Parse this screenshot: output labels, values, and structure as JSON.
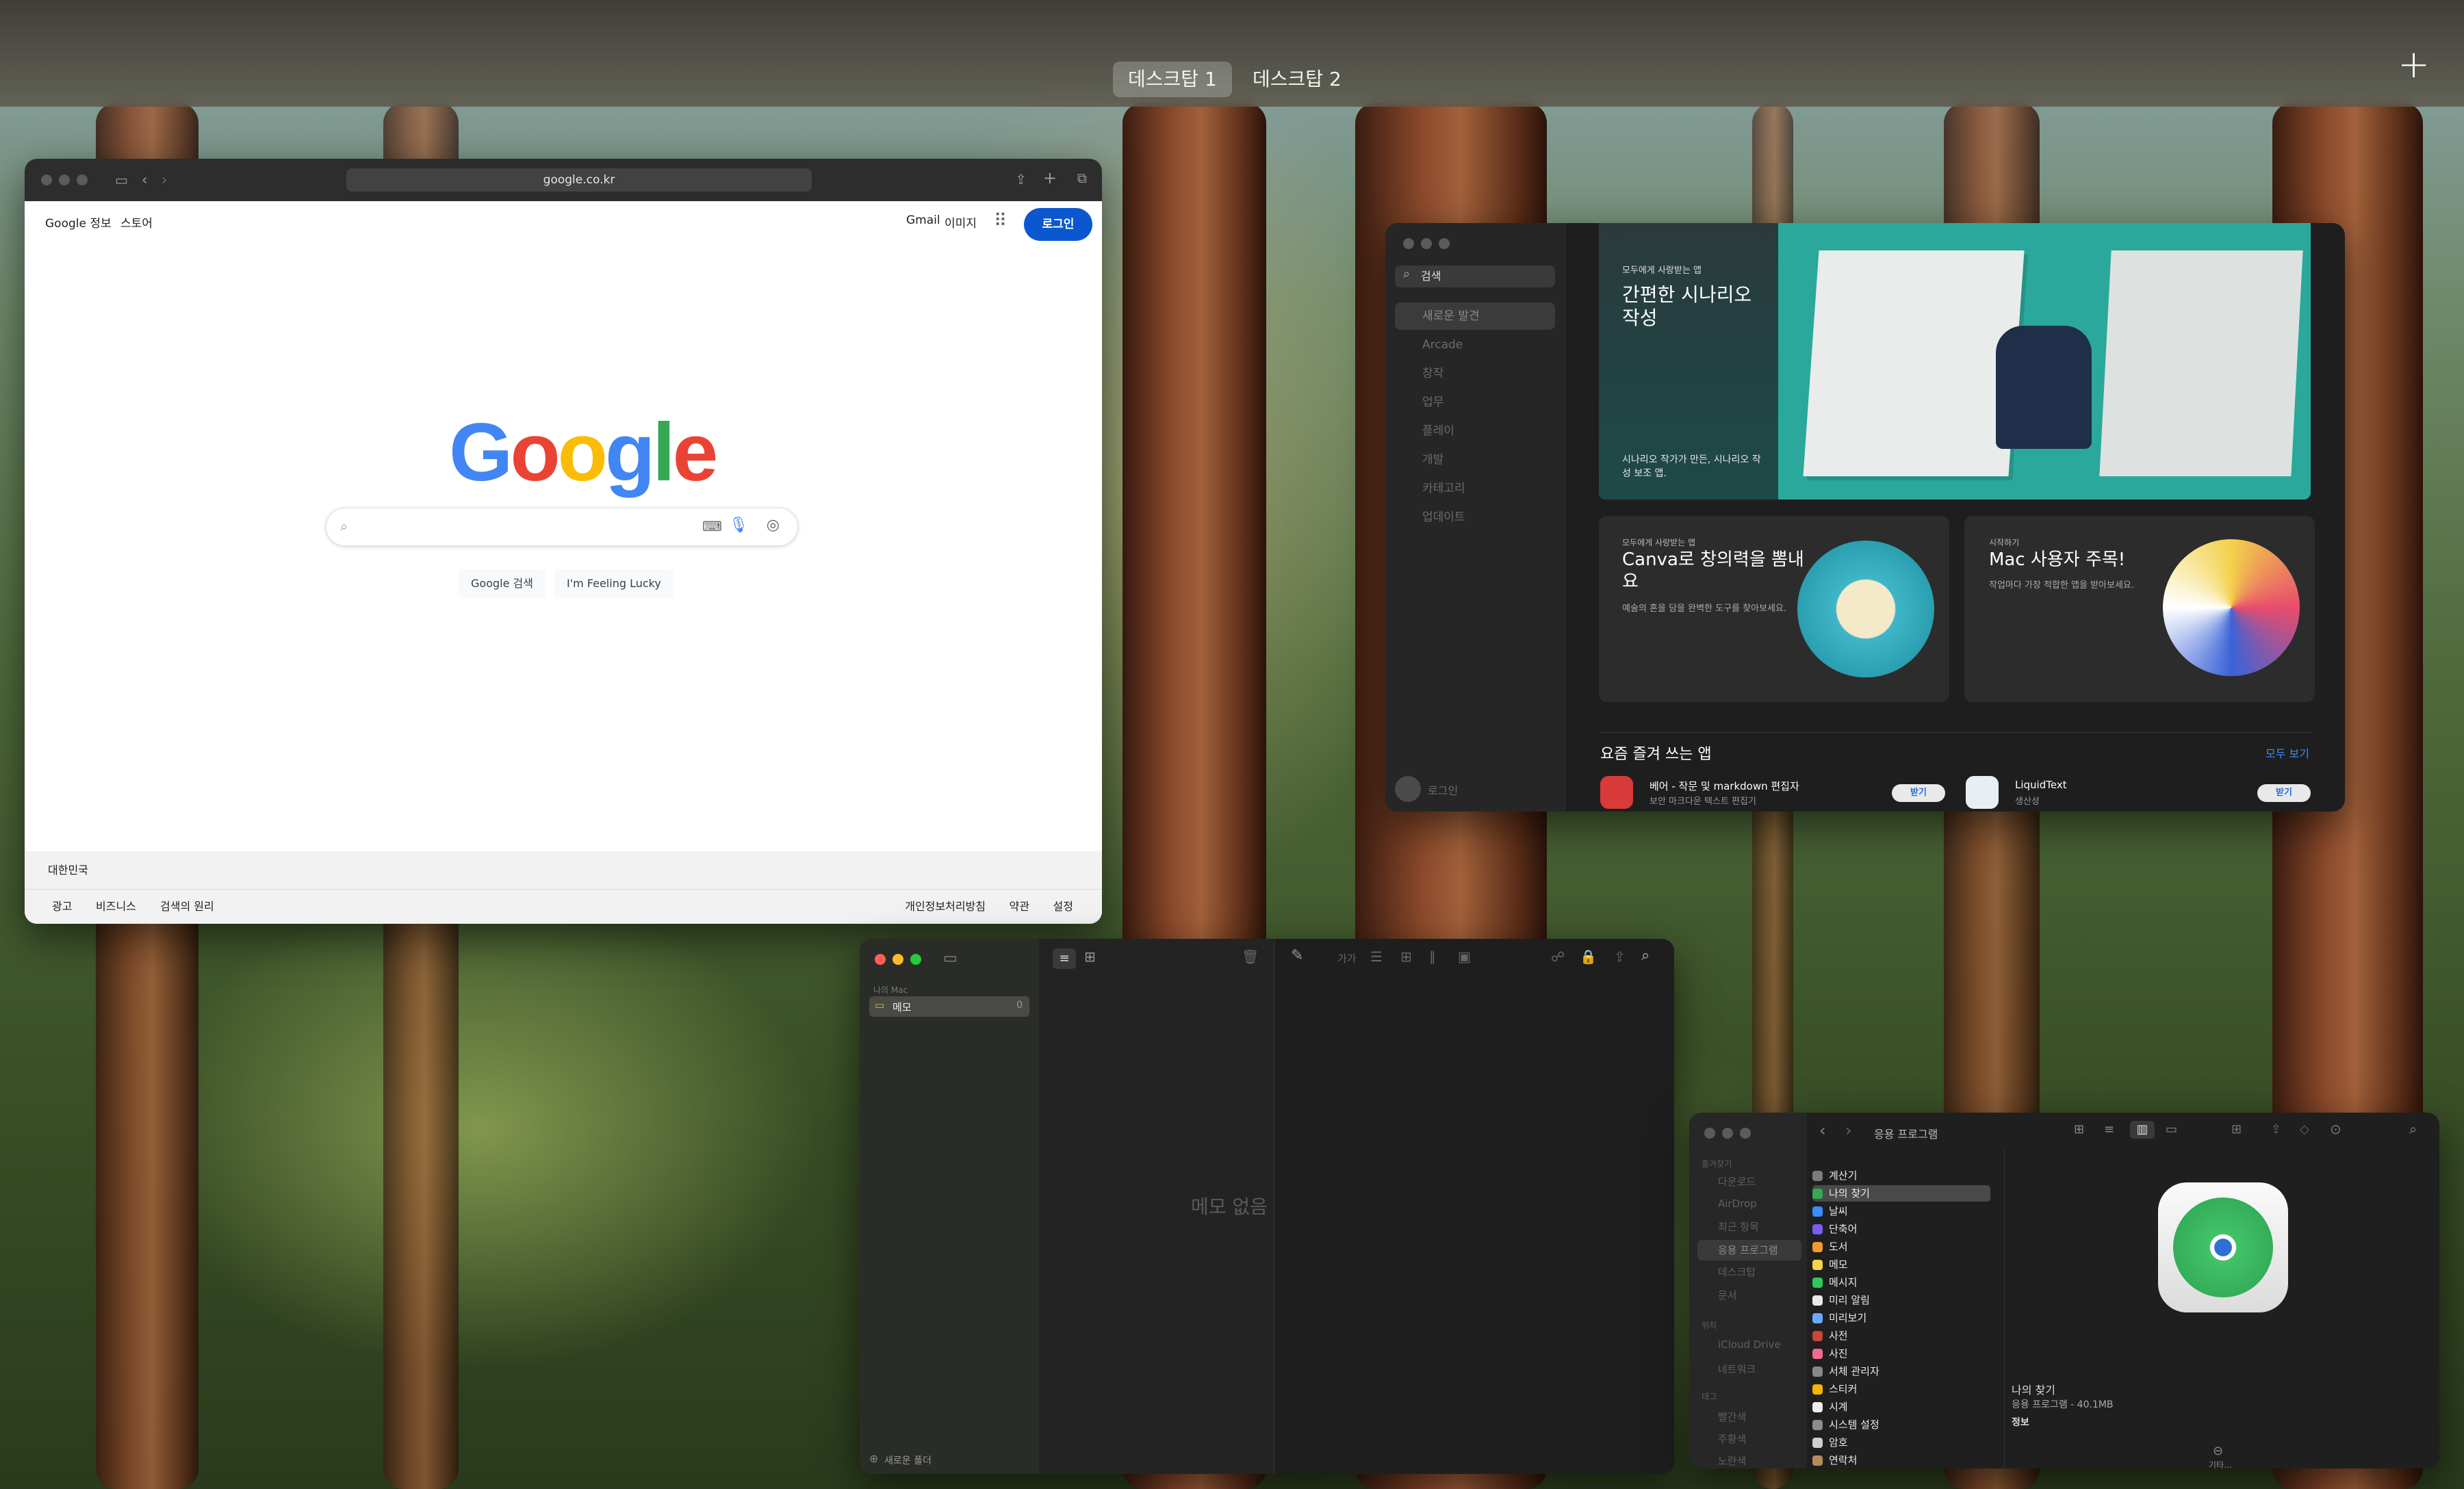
{
  "mission_control": {
    "desktops": [
      "데스크탑 1",
      "데스크탑 2"
    ],
    "add_desktop": "+"
  },
  "safari": {
    "url": "google.co.kr",
    "google_top_left": [
      "Google 정보",
      "스토어"
    ],
    "google_top_right": [
      "Gmail",
      "이미지"
    ],
    "login": "로그인",
    "logo": "Google",
    "search_button": "Google 검색",
    "lucky_button": "I'm Feeling Lucky",
    "country": "대한민국",
    "footer_left": [
      "광고",
      "비즈니스",
      "검색의 원리"
    ],
    "footer_right": [
      "개인정보처리방침",
      "약관",
      "설정"
    ]
  },
  "appstore": {
    "search_placeholder": "검색",
    "sidebar": [
      "새로운 발견",
      "Arcade",
      "창작",
      "업무",
      "플레이",
      "개발",
      "카테고리",
      "업데이트"
    ],
    "login": "로그인",
    "hero": {
      "eyebrow": "모두에게 사랑받는 앱",
      "title": "간편한 시나리오 작성",
      "subtitle": "시나리오 작가가 만든, 시나리오 작성 보조 앱."
    },
    "card1": {
      "eyebrow": "모두에게 사랑받는 앱",
      "title": "Canva로 창의력을 뽐내요",
      "desc": "예술의 혼을 담을 완벽한 도구를 찾아보세요."
    },
    "card2": {
      "eyebrow": "시작하기",
      "title": "Mac 사용자 주목!",
      "desc": "작업마다 가장 적합한 앱을 받아보세요."
    },
    "section_title": "요즘 즐겨 쓰는 앱",
    "see_all": "모두 보기",
    "apps": [
      {
        "name": "베어 - 작문 및 markdown 편집자",
        "sub": "보안 마크다운 텍스트 편집기",
        "button": "받기"
      },
      {
        "name": "LiquidText",
        "sub": "생산성",
        "button": "받기"
      }
    ]
  },
  "notes": {
    "section": "나의 Mac",
    "folder": "메모",
    "folder_count": "0",
    "empty": "메모 없음",
    "new_folder": "새로운 폴더",
    "toolbar_aa": "가가"
  },
  "finder": {
    "title": "응용 프로그램",
    "favorites_header": "즐겨찾기",
    "favorites": [
      "다운로드",
      "AirDrop",
      "최근 항목",
      "응용 프로그램",
      "데스크탑",
      "문서"
    ],
    "locations_header": "위치",
    "locations": [
      "iCloud Drive",
      "네트워크"
    ],
    "tags_header": "태그",
    "tags": [
      "빨간색",
      "주황색",
      "노란색"
    ],
    "apps": [
      "계산기",
      "나의 찾기",
      "날씨",
      "단축어",
      "도서",
      "메모",
      "메시지",
      "미리 알림",
      "미리보기",
      "사전",
      "사진",
      "서체 관리자",
      "스티커",
      "시계",
      "시스템 설정",
      "암호",
      "연락처"
    ],
    "selected_name": "나의 찾기",
    "selected_info": "응용 프로그램 - 40.1MB",
    "info_header": "정보",
    "more": "기타..."
  }
}
